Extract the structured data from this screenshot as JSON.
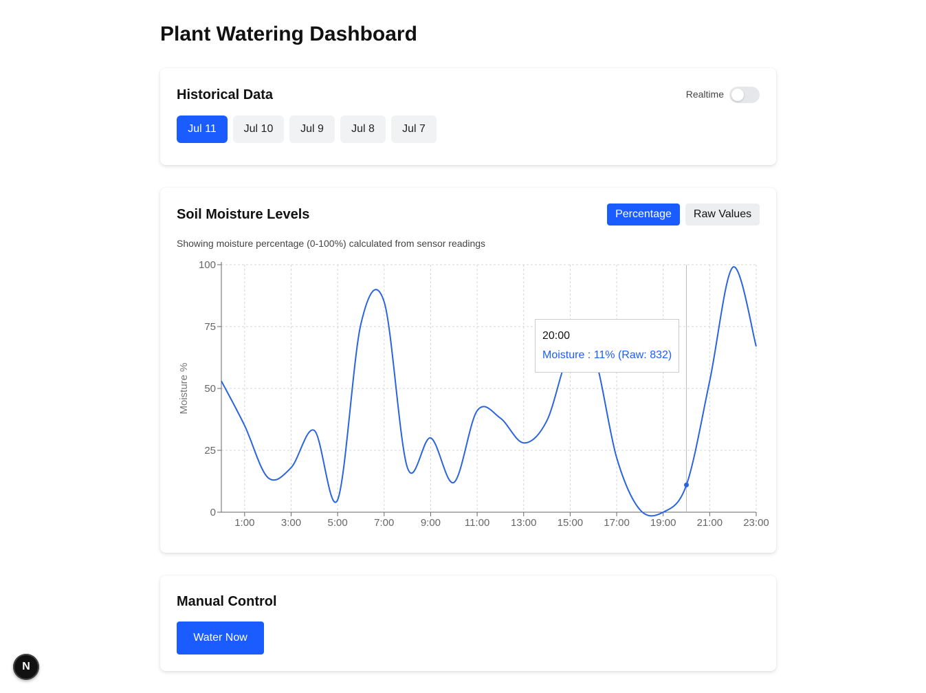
{
  "page": {
    "title": "Plant Watering Dashboard"
  },
  "historical": {
    "title": "Historical Data",
    "realtime_label": "Realtime",
    "realtime_on": false,
    "dates": [
      "Jul 11",
      "Jul 10",
      "Jul 9",
      "Jul 8",
      "Jul 7"
    ],
    "selected_date": "Jul 11"
  },
  "soil": {
    "title": "Soil Moisture Levels",
    "modes": [
      "Percentage",
      "Raw Values"
    ],
    "selected_mode": "Percentage",
    "subtitle": "Showing moisture percentage (0-100%) calculated from sensor readings",
    "tooltip": {
      "time": "20:00",
      "value": "Moisture : 11% (Raw: 832)"
    }
  },
  "manual": {
    "title": "Manual Control",
    "water_label": "Water Now"
  },
  "badge": {
    "label": "N"
  },
  "colors": {
    "accent": "#1a5cff",
    "line": "#2a63e0"
  },
  "chart_data": {
    "type": "line",
    "ylabel": "Moisture %",
    "ylim": [
      0,
      100
    ],
    "yticks": [
      0,
      25,
      50,
      75,
      100
    ],
    "xticks": [
      "1:00",
      "3:00",
      "5:00",
      "7:00",
      "9:00",
      "11:00",
      "13:00",
      "15:00",
      "17:00",
      "19:00",
      "21:00",
      "23:00"
    ],
    "grid": true,
    "x": [
      "0:00",
      "1:00",
      "2:00",
      "3:00",
      "4:00",
      "5:00",
      "6:00",
      "7:00",
      "8:00",
      "9:00",
      "10:00",
      "11:00",
      "12:00",
      "13:00",
      "14:00",
      "15:00",
      "16:00",
      "17:00",
      "18:00",
      "19:00",
      "20:00",
      "21:00",
      "22:00",
      "23:00"
    ],
    "series": [
      {
        "values": [
          53,
          35,
          14,
          18,
          33,
          5,
          76,
          85,
          18,
          30,
          12,
          41,
          38,
          28,
          37,
          65,
          64,
          22,
          1,
          0,
          11,
          53,
          99,
          67
        ]
      }
    ],
    "highlight": {
      "x": "20:00",
      "value": 11
    }
  }
}
